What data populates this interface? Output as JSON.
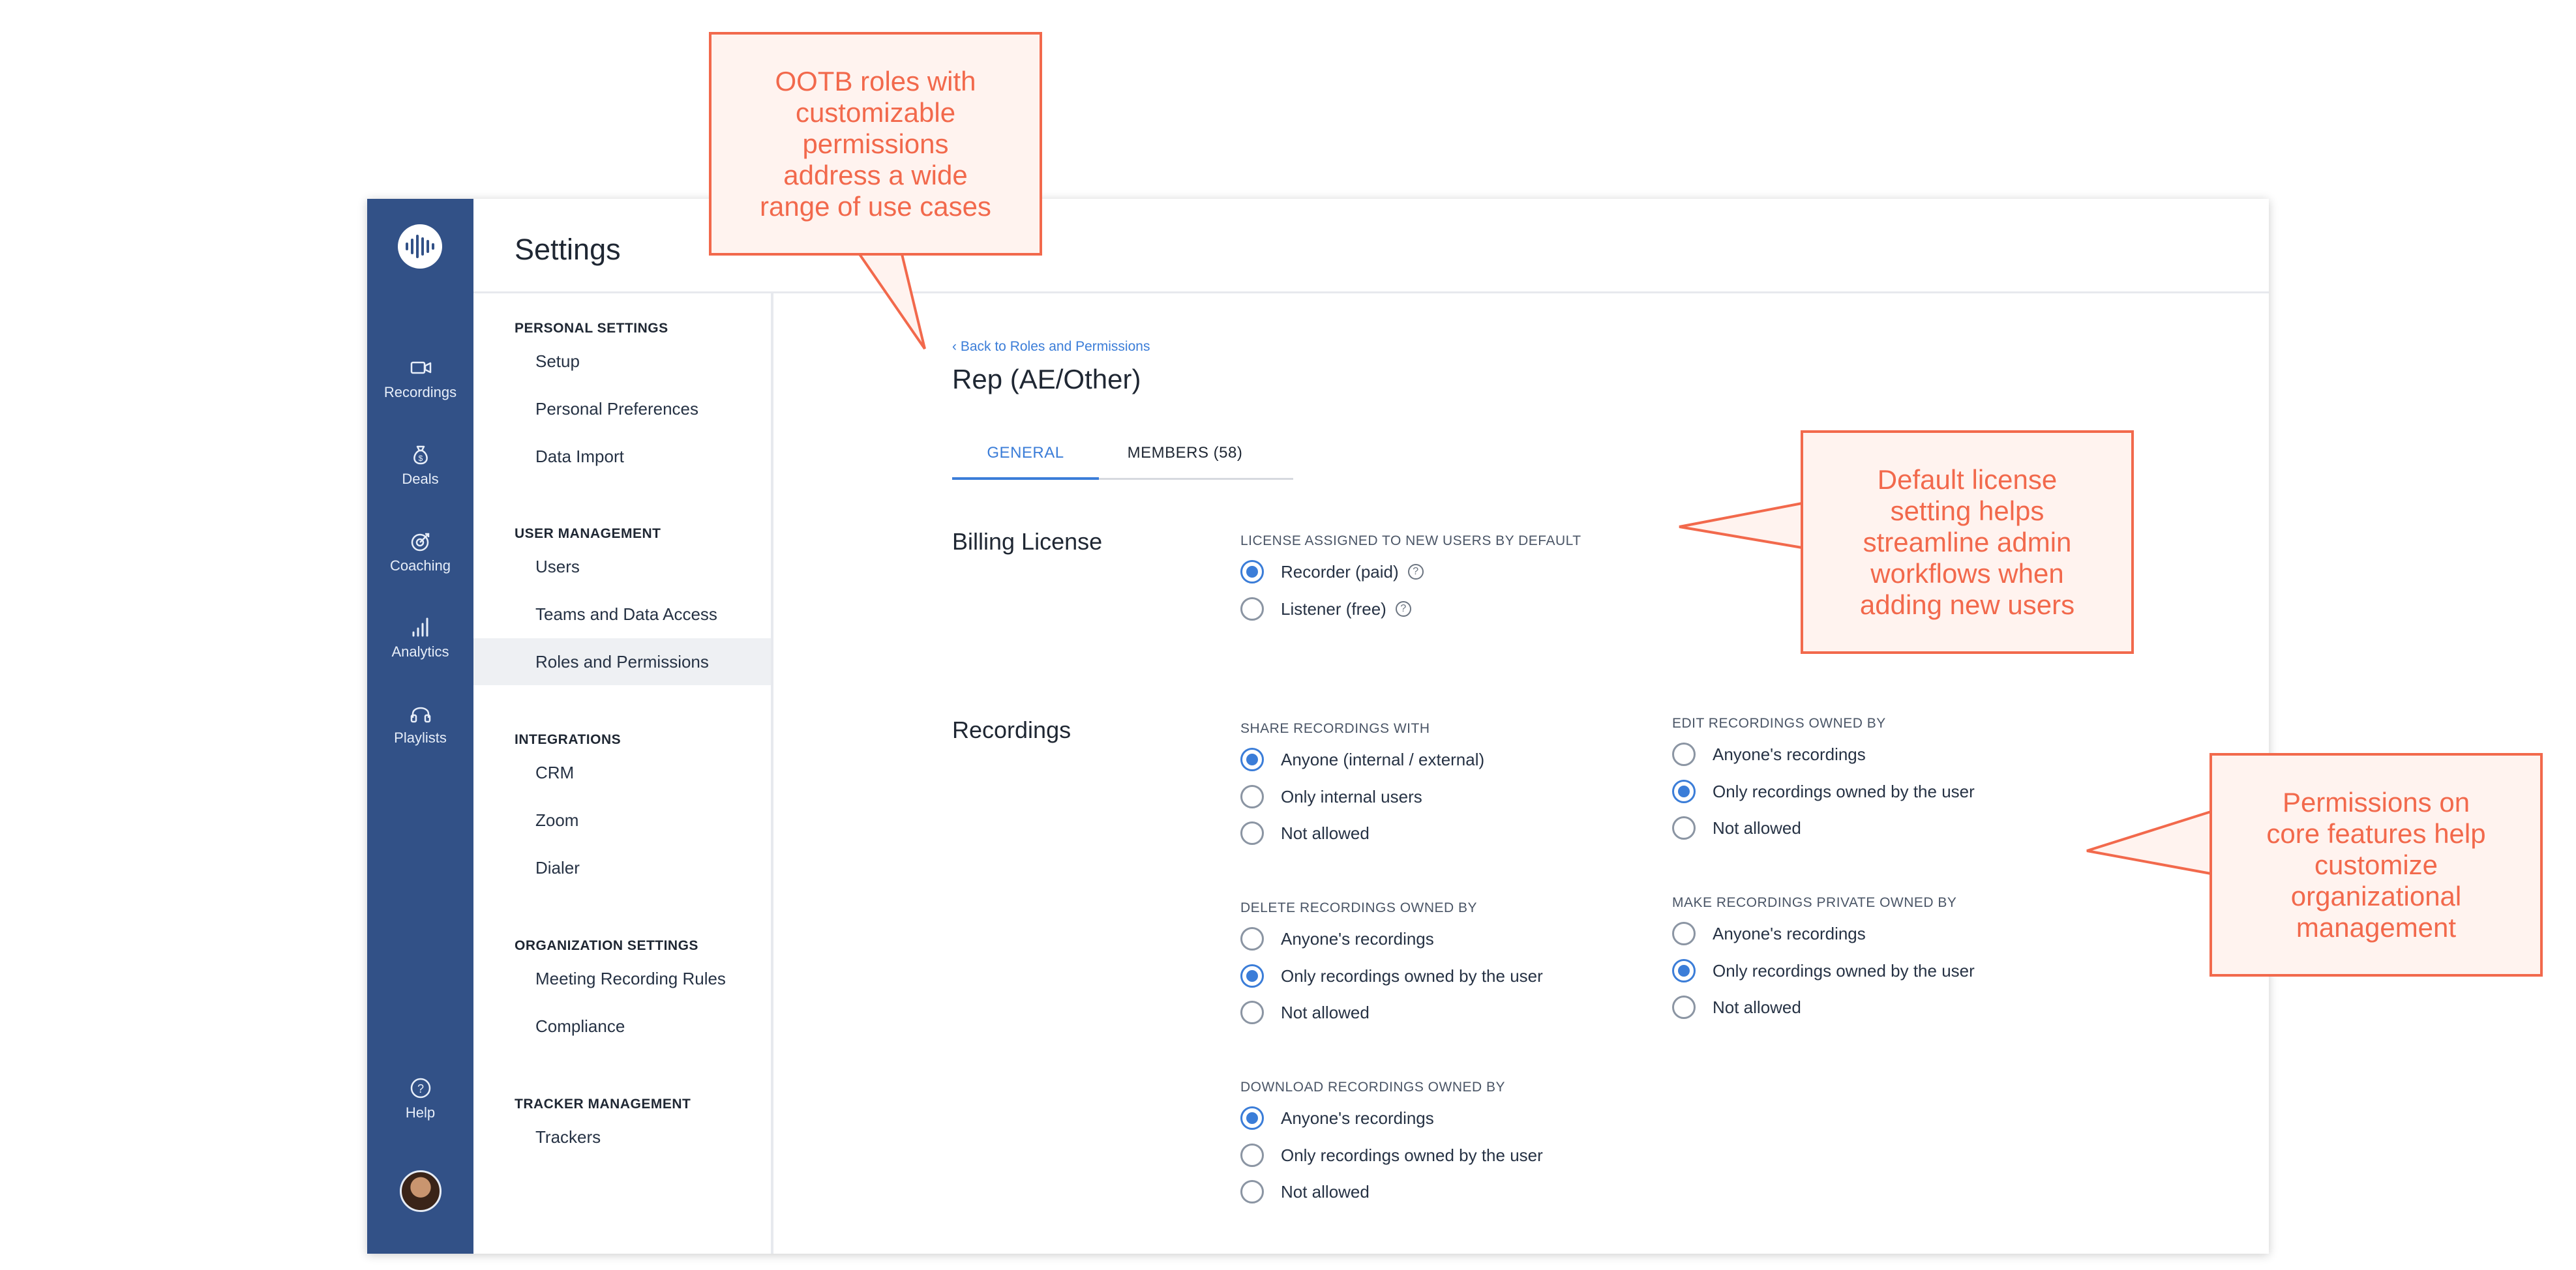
{
  "app": {
    "header_title": "Settings",
    "rail": {
      "logo_icon": "waveform-logo",
      "items": [
        {
          "label": "Recordings",
          "icon": "video-camera-icon"
        },
        {
          "label": "Deals",
          "icon": "money-bag-icon"
        },
        {
          "label": "Coaching",
          "icon": "target-icon"
        },
        {
          "label": "Analytics",
          "icon": "bar-chart-icon"
        },
        {
          "label": "Playlists",
          "icon": "headphones-icon"
        }
      ],
      "help_label": "Help",
      "help_icon": "question-circle-icon"
    },
    "subnav": {
      "sections": [
        {
          "title": "PERSONAL SETTINGS",
          "items": [
            "Setup",
            "Personal Preferences",
            "Data Import"
          ]
        },
        {
          "title": "USER MANAGEMENT",
          "items": [
            "Users",
            "Teams and Data Access",
            "Roles and Permissions"
          ]
        },
        {
          "title": "INTEGRATIONS",
          "items": [
            "CRM",
            "Zoom",
            "Dialer"
          ]
        },
        {
          "title": "ORGANIZATION SETTINGS",
          "items": [
            "Meeting Recording Rules",
            "Compliance"
          ]
        },
        {
          "title": "TRACKER MANAGEMENT",
          "items": [
            "Trackers"
          ]
        }
      ],
      "active_item": "Roles and Permissions"
    },
    "main": {
      "back_link": "Back to Roles and Permissions",
      "page_title": "Rep (AE/Other)",
      "tabs": {
        "general": "GENERAL",
        "members": "MEMBERS (58)"
      },
      "billing": {
        "title": "Billing License",
        "label": "LICENSE ASSIGNED TO NEW USERS BY DEFAULT",
        "options": [
          {
            "label": "Recorder (paid)",
            "selected": true
          },
          {
            "label": "Listener (free)",
            "selected": false
          }
        ]
      },
      "recordings": {
        "title": "Recordings",
        "share": {
          "label": "SHARE RECORDINGS WITH",
          "options": [
            {
              "label": "Anyone (internal / external)",
              "selected": true
            },
            {
              "label": "Only internal users",
              "selected": false
            },
            {
              "label": "Not allowed",
              "selected": false
            }
          ]
        },
        "delete": {
          "label": "DELETE RECORDINGS OWNED BY",
          "options": [
            {
              "label": "Anyone's recordings",
              "selected": false
            },
            {
              "label": "Only recordings owned by the user",
              "selected": true
            },
            {
              "label": "Not allowed",
              "selected": false
            }
          ]
        },
        "download": {
          "label": "DOWNLOAD RECORDINGS OWNED BY",
          "options": [
            {
              "label": "Anyone's recordings",
              "selected": true
            },
            {
              "label": "Only recordings owned by the user",
              "selected": false
            },
            {
              "label": "Not allowed",
              "selected": false
            }
          ]
        },
        "edit": {
          "label": "EDIT RECORDINGS OWNED BY",
          "options": [
            {
              "label": "Anyone's recordings",
              "selected": false
            },
            {
              "label": "Only recordings owned by the user",
              "selected": true
            },
            {
              "label": "Not allowed",
              "selected": false
            }
          ]
        },
        "private": {
          "label": "MAKE RECORDINGS PRIVATE OWNED BY",
          "options": [
            {
              "label": "Anyone's recordings",
              "selected": false
            },
            {
              "label": "Only recordings owned by the user",
              "selected": true
            },
            {
              "label": "Not allowed",
              "selected": false
            }
          ]
        }
      }
    }
  },
  "callouts": {
    "roles": [
      "OOTB roles with",
      "customizable",
      "permissions",
      "address a wide",
      "range of use cases"
    ],
    "license": [
      "Default license",
      "setting helps",
      "streamline admin",
      "workflows when",
      "adding new users"
    ],
    "permissions": [
      "Permissions on",
      "core features help",
      "customize",
      "organizational",
      "management"
    ]
  },
  "colors": {
    "accent": "#3b7dd8",
    "rail": "#325187",
    "callout": "#f2694c",
    "callout_bg": "#fff3ef"
  }
}
